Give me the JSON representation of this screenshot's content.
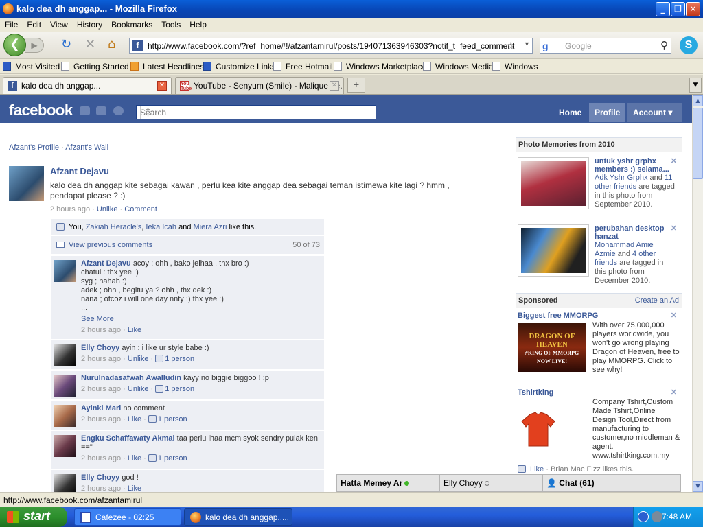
{
  "window": {
    "title": "kalo dea dh anggap... - Mozilla Firefox"
  },
  "menu": [
    "File",
    "Edit",
    "View",
    "History",
    "Bookmarks",
    "Tools",
    "Help"
  ],
  "nav": {
    "url": "http://www.facebook.com/?ref=home#!/afzantamirul/posts/194071363946303?notif_t=feed_comment",
    "search_placeholder": "Google"
  },
  "bookmarks": [
    "Most Visited",
    "Getting Started",
    "Latest Headlines",
    "Customize Links",
    "Free Hotmail",
    "Windows Marketplace",
    "Windows Media",
    "Windows"
  ],
  "tabs": [
    {
      "label": "kalo dea dh anggap..."
    },
    {
      "label": "YouTube - Senyum (Smile) - Malique Fe..."
    }
  ],
  "fb": {
    "logo": "facebook",
    "search_placeholder": "Search",
    "nav": {
      "home": "Home",
      "profile": "Profile",
      "account": "Account ▾"
    }
  },
  "breadcrumb": {
    "profile": "Afzant's Profile",
    "sep": "·",
    "wall": "Afzant's Wall"
  },
  "post": {
    "author": "Afzant Dejavu",
    "text": "kalo dea dh anggap kite sebagai kawan , perlu kea kite anggap dea sebagai teman istimewa kite lagi ? hmm , pendapat please ? :)",
    "time": "2 hours ago",
    "unlike": "Unlike",
    "comment": "Comment",
    "likes": {
      "you": "You,",
      "n1": "Zakiah Heracle's",
      "n2": "Ieka Icah",
      "and": "and",
      "n3": "Miera Azri",
      "tail": "like this."
    },
    "view_previous": "View previous comments",
    "count": "50 of 73"
  },
  "comments": [
    {
      "name": "Afzant Dejavu",
      "text": "acoy ; ohh , bako jelhaa . thx bro :)",
      "lines": [
        "chatul : thx yee :)",
        "syg ; hahah :)",
        "adek ; ohh , begitu ya ? ohh , thx dek :)",
        "nana ; ofcoz i will one day nnty :) thx yee :)",
        "..."
      ],
      "see_more": "See More",
      "time": "2 hours ago",
      "action": "Like"
    },
    {
      "name": "Elly Choyy",
      "text": "ayin : i like ur style babe :)",
      "time": "2 hours ago",
      "action": "Unlike",
      "likes": "1 person"
    },
    {
      "name": "Nurulnadasafwah Awalludin",
      "text": "kayy no biggie biggoo ! :p",
      "time": "2 hours ago",
      "action": "Unlike",
      "likes": "1 person"
    },
    {
      "name": "Ayinkl Mari",
      "text": "no comment",
      "time": "2 hours ago",
      "action": "Like",
      "likes": "1 person"
    },
    {
      "name": "Engku Schaffawaty Akmal",
      "text": "taa perlu lhaa mcm syok sendry pulak ken ==\"",
      "time": "2 hours ago",
      "action": "Like",
      "likes": "1 person"
    },
    {
      "name": "Elly Choyy",
      "text": "god !",
      "time": "2 hours ago",
      "action": "Like"
    }
  ],
  "sidebar": {
    "memories_title": "Photo Memories from 2010",
    "memories": [
      {
        "title": "untuk yshr grphx members :) selama...",
        "p1": "Adk Yshr Grphx",
        "and": "and",
        "p2": "11 other friends",
        "desc": "are tagged in this photo from September 2010."
      },
      {
        "title": "perubahan desktop hanzat",
        "p1": "Mohammad Amie Azmie",
        "and": "and",
        "p2": "4 other friends",
        "desc": "are tagged in this photo from December 2010."
      }
    ],
    "sponsored_title": "Sponsored",
    "create_ad": "Create an Ad",
    "ads": [
      {
        "title": "Biggest free MMORPG",
        "text": "With over 75,000,000 players worldwide, you won't go wrong playing Dragon of Heaven, free to play MMORPG. Click to see why!",
        "img_text": "DRAGON OF HEAVEN",
        "img_sub": "#KING OF MMORPG",
        "img_sub2": "NOW LIVE!"
      },
      {
        "title": "Tshirtking",
        "text": "Company Tshirt,Custom Made Tshirt,Online Design Tool,Direct from manufacturing to customer,no middleman & agent. www.tshirtking.com.my",
        "like": "Like",
        "like_tail": "· Brian Mac Fizz likes this."
      }
    ]
  },
  "chat": {
    "items": [
      {
        "name": "Hatta Memey Ar",
        "status": "online"
      },
      {
        "name": "Elly Choyy",
        "status": "idle"
      }
    ],
    "label": "Chat (61)"
  },
  "colors": {
    "fb_blue": "#3b5998",
    "online": "#42b72a"
  },
  "status_url": "http://www.facebook.com/afzantamirul",
  "taskbar": {
    "start": "start",
    "tasks": [
      "Cafezee - 02:25",
      "kalo dea dh anggap....."
    ],
    "clock": "7:48 AM"
  }
}
